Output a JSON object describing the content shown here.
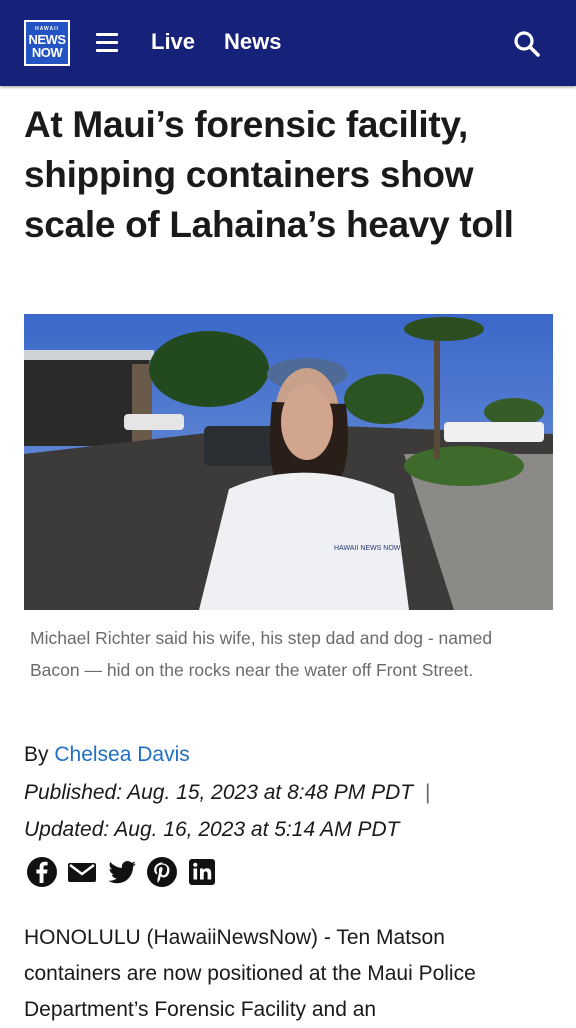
{
  "header": {
    "logo": {
      "line0": "HAWAII",
      "line1": "NEWS",
      "line2": "NOW"
    },
    "nav": {
      "live": "Live",
      "news": "News"
    }
  },
  "article": {
    "headline": "At Maui’s forensic facility, shipping containers show scale of Lahaina’s heavy toll",
    "caption": "Michael Richter said his wife, his step dad and dog - named Bacon — hid on the rocks near the water off Front Street.",
    "photo_watermark": "HAWAII NEWS NOW",
    "byline_prefix": "By",
    "author": "Chelsea Davis",
    "published": "Published: Aug. 15, 2023 at 8:48 PM PDT",
    "separator": "|",
    "updated": "Updated: Aug. 16, 2023 at 5:14 AM PDT",
    "share_icons": [
      "facebook-icon",
      "email-icon",
      "twitter-icon",
      "pinterest-icon",
      "linkedin-icon"
    ],
    "body": "HONOLULU (HawaiiNewsNow) - Ten Matson containers are now positioned at the Maui Police Department’s Forensic Facility and an"
  },
  "colors": {
    "header_bg": "#16217a",
    "author_link": "#1f6fc4",
    "caption_text": "#6b6b6b"
  }
}
